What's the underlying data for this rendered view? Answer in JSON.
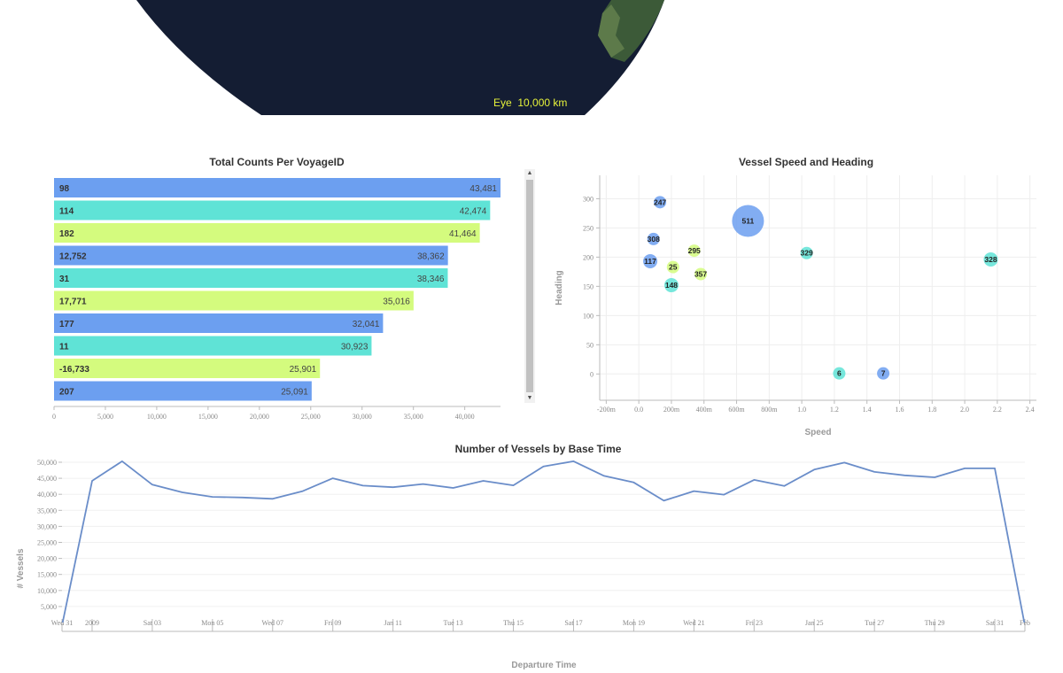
{
  "globe": {
    "eye_label": "Eye",
    "eye_value": "10,000 km"
  },
  "colors": {
    "blue": "#6c9ff0",
    "teal": "#5fe3d6",
    "lime": "#d4fb7e",
    "line": "#6a8dc9",
    "ocean": "#141d33",
    "land": "#3c5a38"
  },
  "chart_data": [
    {
      "type": "bar",
      "orientation": "horizontal",
      "title": "Total Counts Per VoyageID",
      "categories": [
        "98",
        "114",
        "182",
        "12,752",
        "31",
        "17,771",
        "177",
        "11",
        "-16,733",
        "207"
      ],
      "values": [
        43481,
        42474,
        41464,
        38362,
        38346,
        35016,
        32041,
        30923,
        25901,
        25091
      ],
      "value_labels": [
        "43,481",
        "42,474",
        "41,464",
        "38,362",
        "38,346",
        "35,016",
        "32,041",
        "30,923",
        "25,901",
        "25,091"
      ],
      "bar_colors": [
        "#6c9ff0",
        "#5fe3d6",
        "#d4fb7e",
        "#6c9ff0",
        "#5fe3d6",
        "#d4fb7e",
        "#6c9ff0",
        "#5fe3d6",
        "#d4fb7e",
        "#6c9ff0"
      ],
      "xlim": [
        0,
        43481
      ],
      "x_ticks": [
        0,
        5000,
        10000,
        15000,
        20000,
        25000,
        30000,
        35000,
        40000
      ],
      "x_tick_labels": [
        "0",
        "5,000",
        "10,000",
        "15,000",
        "20,000",
        "25,000",
        "30,000",
        "35,000",
        "40,000"
      ]
    },
    {
      "type": "scatter",
      "title": "Vessel Speed and Heading",
      "xlabel": "Speed",
      "ylabel": "Heading",
      "xlim": [
        -0.24,
        2.44
      ],
      "ylim": [
        -45,
        340
      ],
      "x_ticks": [
        -0.2,
        0,
        0.2,
        0.4,
        0.6,
        0.8,
        1.0,
        1.2,
        1.4,
        1.6,
        1.8,
        2.0,
        2.2,
        2.4
      ],
      "x_tick_labels": [
        "-200m",
        "0.0",
        "200m",
        "400m",
        "600m",
        "800m",
        "1.0",
        "1.2",
        "1.4",
        "1.6",
        "1.8",
        "2.0",
        "2.2",
        "2.4"
      ],
      "y_ticks": [
        0,
        50,
        100,
        150,
        200,
        250,
        300
      ],
      "y_tick_labels": [
        "0",
        "50",
        "100",
        "150",
        "200",
        "250",
        "300"
      ],
      "grid": true,
      "points": [
        {
          "label": "247",
          "x": 0.13,
          "y": 294,
          "size": 7,
          "color": "#6c9ff0"
        },
        {
          "label": "511",
          "x": 0.67,
          "y": 262,
          "size": 18,
          "color": "#6c9ff0"
        },
        {
          "label": "308",
          "x": 0.09,
          "y": 231,
          "size": 7,
          "color": "#6c9ff0"
        },
        {
          "label": "295",
          "x": 0.34,
          "y": 211,
          "size": 7,
          "color": "#d4fb7e"
        },
        {
          "label": "329",
          "x": 1.03,
          "y": 207,
          "size": 7,
          "color": "#5fe3d6"
        },
        {
          "label": "328",
          "x": 2.16,
          "y": 196,
          "size": 8,
          "color": "#5fe3d6"
        },
        {
          "label": "117",
          "x": 0.07,
          "y": 193,
          "size": 8,
          "color": "#6c9ff0"
        },
        {
          "label": "25",
          "x": 0.21,
          "y": 183,
          "size": 7,
          "color": "#d4fb7e"
        },
        {
          "label": "357",
          "x": 0.38,
          "y": 171,
          "size": 7,
          "color": "#d4fb7e"
        },
        {
          "label": "148",
          "x": 0.2,
          "y": 152,
          "size": 8,
          "color": "#5fe3d6"
        },
        {
          "label": "6",
          "x": 1.23,
          "y": 1,
          "size": 7,
          "color": "#5fe3d6"
        },
        {
          "label": "7",
          "x": 1.5,
          "y": 1,
          "size": 7,
          "color": "#6c9ff0"
        }
      ]
    },
    {
      "type": "line",
      "title": "Number of Vessels by Base Time",
      "xlabel": "Departure Time",
      "ylabel": "# Vessels",
      "x_tick_labels": [
        "Wed 31",
        "2009",
        "Sat 03",
        "Mon 05",
        "Wed 07",
        "Fri 09",
        "Jan 11",
        "Tue 13",
        "Thu 15",
        "Sat 17",
        "Mon 19",
        "Wed 21",
        "Fri 23",
        "Jan 25",
        "Tue 27",
        "Thu 29",
        "Sat 31",
        "Feb"
      ],
      "x_tick_days": [
        0,
        1,
        3,
        5,
        7,
        9,
        11,
        13,
        15,
        17,
        19,
        21,
        23,
        25,
        27,
        29,
        31,
        32
      ],
      "xlim": [
        0,
        32
      ],
      "ylim": [
        0,
        50000
      ],
      "y_ticks": [
        5000,
        10000,
        15000,
        20000,
        25000,
        30000,
        35000,
        40000,
        45000,
        50000
      ],
      "y_tick_labels": [
        "5,000",
        "10,000",
        "15,000",
        "20,000",
        "25,000",
        "30,000",
        "35,000",
        "40,000",
        "45,000",
        "50,000"
      ],
      "series": [
        {
          "x": [
            0.02,
            1,
            2,
            3,
            4,
            5,
            6,
            7,
            8,
            9,
            10,
            11,
            12,
            13,
            14,
            15,
            16,
            17,
            18,
            19,
            20,
            21,
            22,
            23,
            24,
            25,
            26,
            27,
            28,
            29,
            30,
            31,
            31.98
          ],
          "y": [
            0,
            44200,
            50300,
            43000,
            40600,
            39200,
            39000,
            38600,
            41000,
            45000,
            42700,
            42200,
            43200,
            42000,
            44200,
            42800,
            48700,
            50300,
            45800,
            43700,
            38000,
            41000,
            39900,
            44500,
            42600,
            47700,
            49900,
            47000,
            45900,
            45300,
            48100,
            48100,
            0
          ]
        }
      ]
    }
  ]
}
